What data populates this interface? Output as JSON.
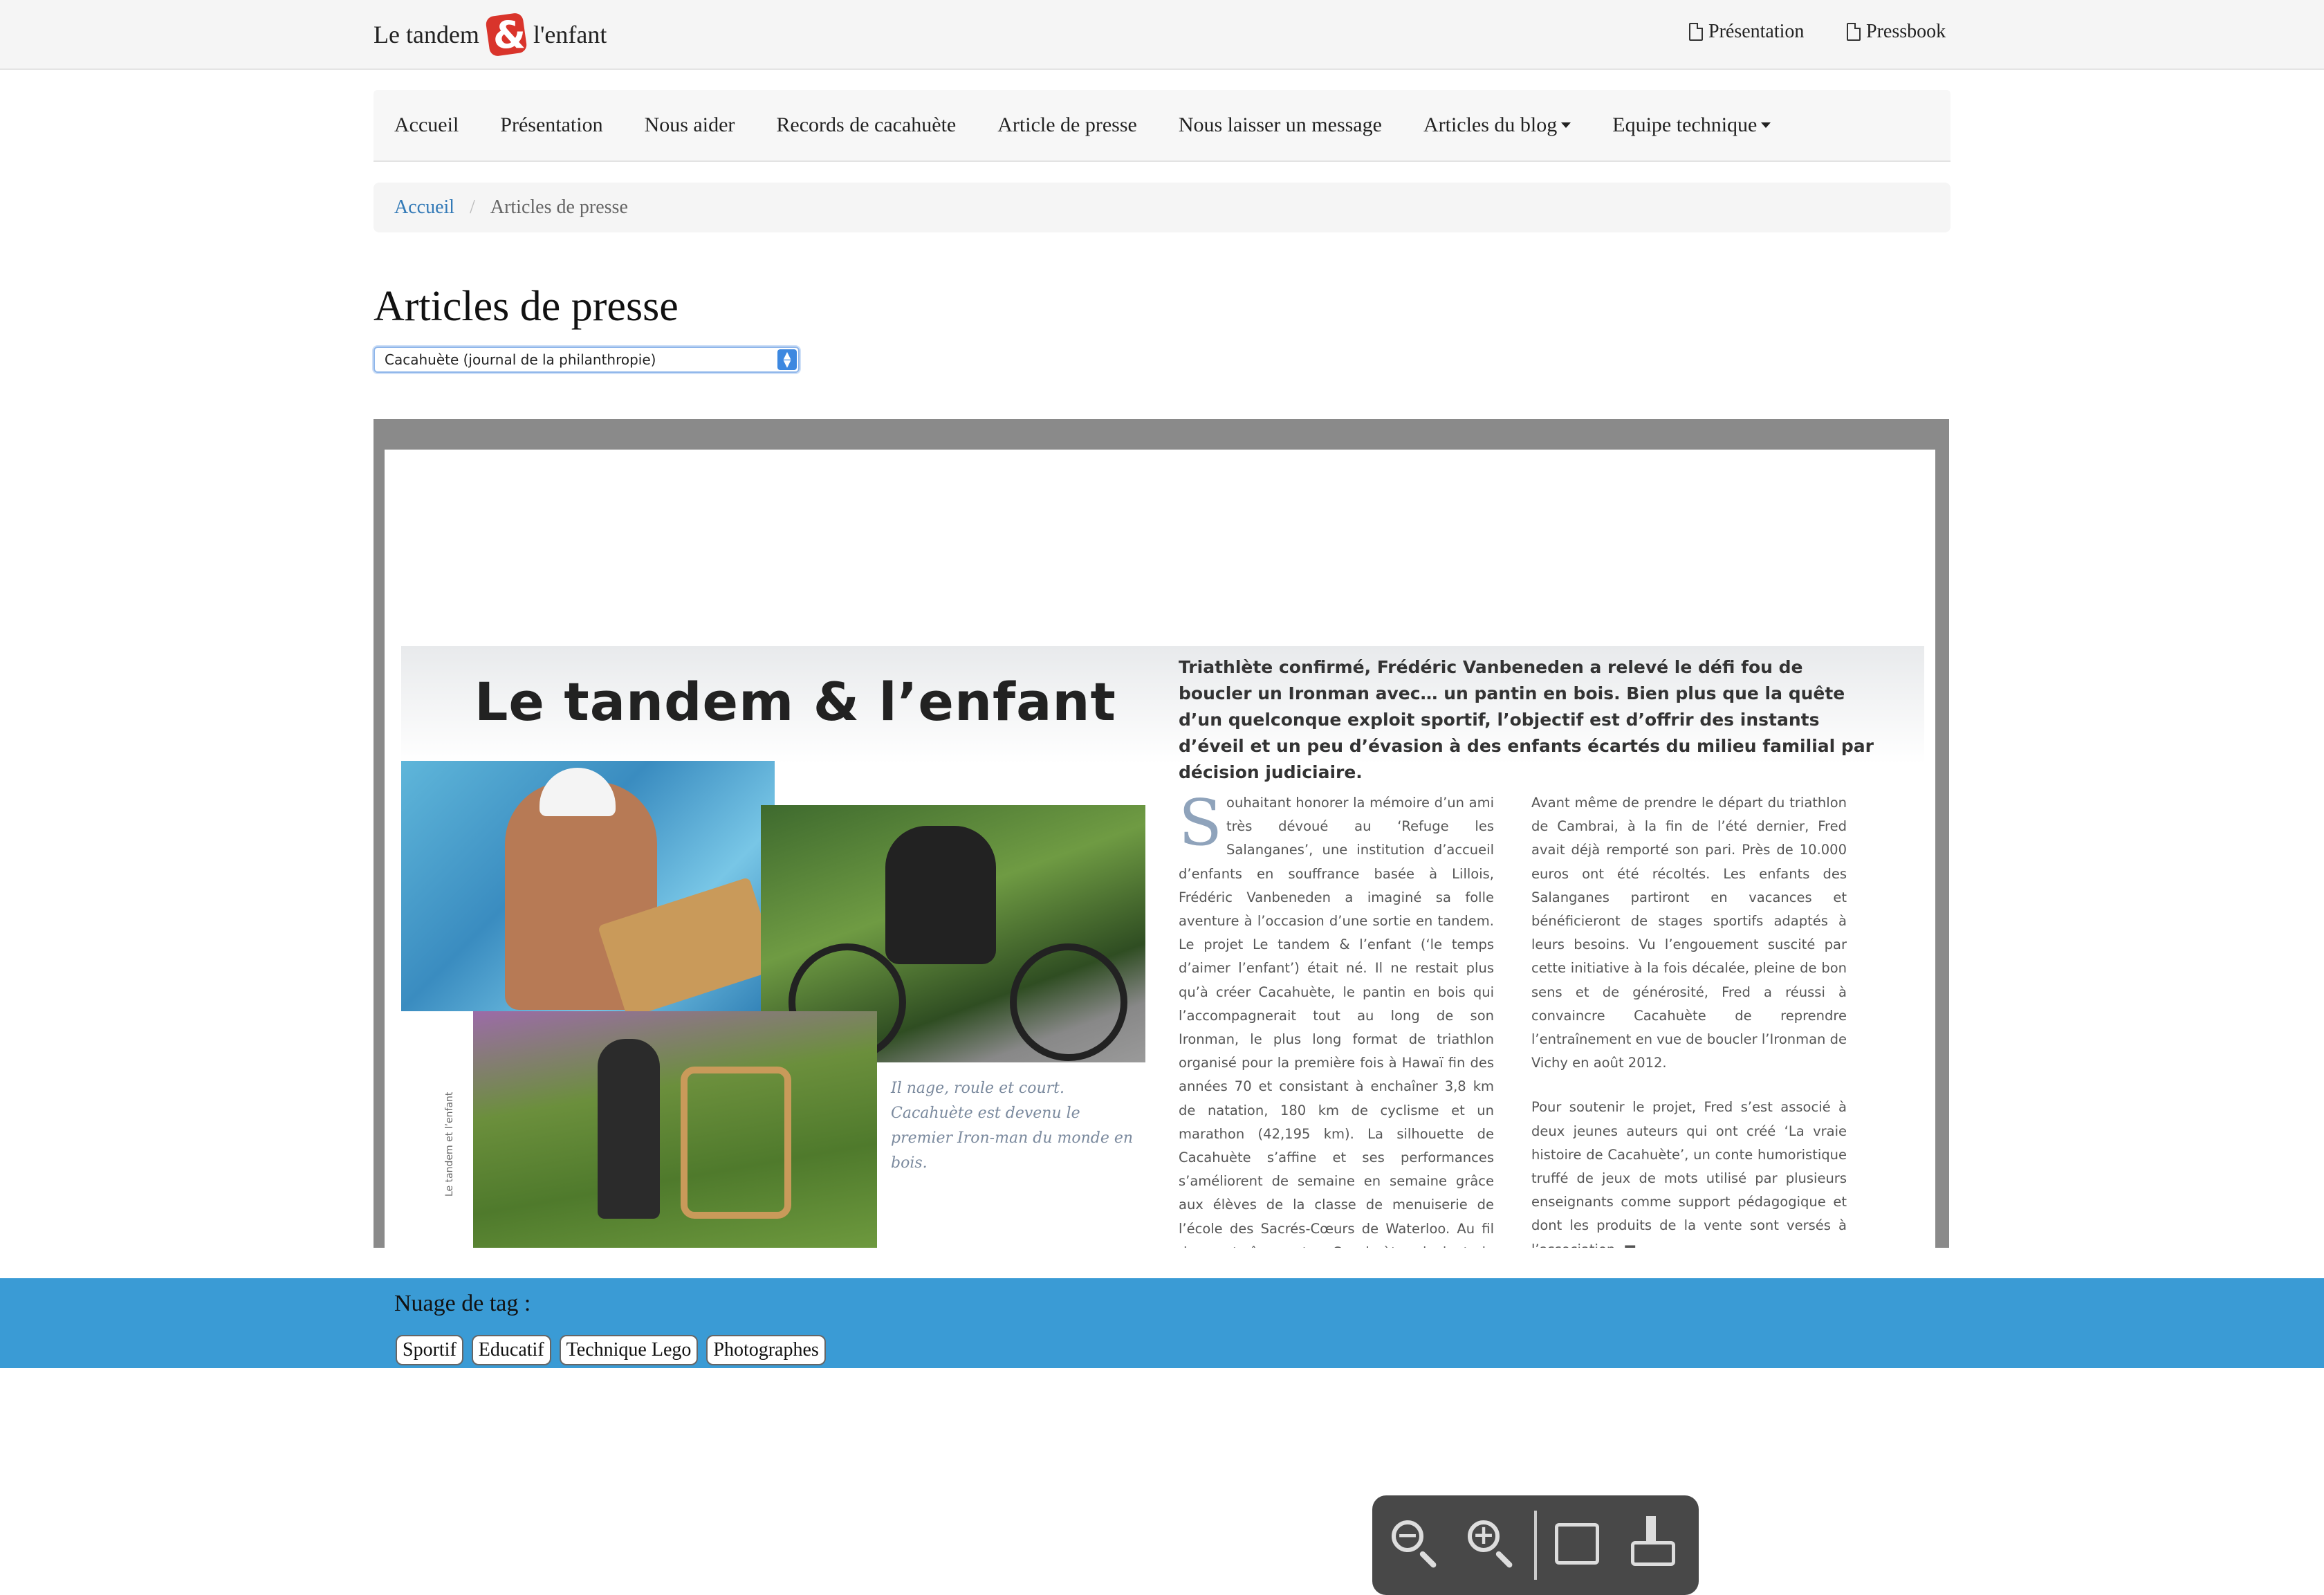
{
  "header": {
    "brand_left": "Le tandem",
    "brand_logo_letter": "&",
    "brand_right": "l'enfant",
    "links": [
      {
        "label": "Présentation",
        "icon": "pdf-icon"
      },
      {
        "label": "Pressbook",
        "icon": "pdf-icon"
      }
    ]
  },
  "nav": {
    "items": [
      {
        "label": "Accueil"
      },
      {
        "label": "Présentation"
      },
      {
        "label": "Nous aider"
      },
      {
        "label": "Records de cacahuète"
      },
      {
        "label": "Article de presse"
      },
      {
        "label": "Nous laisser un message"
      },
      {
        "label": "Articles du blog",
        "dropdown": true
      },
      {
        "label": "Equipe technique",
        "dropdown": true
      }
    ]
  },
  "breadcrumb": {
    "home": "Accueil",
    "separator": "/",
    "current": "Articles de presse"
  },
  "page_title": "Articles de presse",
  "article_select": {
    "selected": "Cacahuète (journal de la philanthropie)"
  },
  "document": {
    "title": "Le tandem & l’enfant",
    "intro": "Triathlète confirmé, Frédéric Vanbeneden a relevé le défi fou de boucler un Ironman avec… un pantin en bois. Bien plus que la quête d’un quelconque exploit sportif, l’objectif est d’offrir des instants d’éveil et un peu d’évasion à des enfants écartés du milieu familial par décision judiciaire.",
    "col1_dropcap": "S",
    "col1_text": "ouhaitant honorer la mémoire d’un ami très dévoué au ‘Refuge les Salanganes’, une institution d’accueil d’enfants en souffrance basée à Lillois, Frédéric Vanbeneden a imaginé sa folle aventure à l’occasion d’une sortie en tandem. Le projet Le tandem & l’enfant (‘le temps d’aimer l’enfant’) était né. Il ne restait plus qu’à créer Cacahuète, le pantin en bois qui l’accompagnerait tout au long de son Ironman, le plus long format de triathlon organisé pour la première fois à Hawaï fin des années 70 et consistant à enchaîner 3,8 km de natation, 180 km de cyclisme et un marathon (42,195 km). La silhouette de Cacahuète s’affine et ses performances s’améliorent de semaine en semaine grâce aux élèves de la classe de menuiserie de l’école des Sacrés-Cœurs de Waterloo. Au fil des entraînements, Cacahuète devient le héros de tout un quartier. Les messages de soutien s’accumulent sur le site du projet et les",
    "col2_p1": "Avant même de prendre le départ du triathlon de Cambrai, à la fin de l’été dernier, Fred avait déjà remporté son pari. Près de 10.000 euros ont été récoltés. Les enfants des Salanganes partiront en vacances et bénéficieront de stages sportifs adaptés à leurs besoins. Vu l’engouement suscité par cette initiative à la fois décalée, pleine de bon sens et de générosité, Fred a réussi à convaincre Cacahuète de reprendre l’entraînement en vue de boucler l’Ironman de Vichy en août 2012.",
    "col2_p2": "Pour soutenir le projet, Fred s’est associé à deux jeunes auteurs qui ont créé ‘La vraie histoire de Cacahuète’, un conte humoristique truffé de jeux de mots utilisé par plusieurs enseignants comme support pédagogique et dont les produits de la vente sont versés à l’association. ■",
    "photo_caption": "Il nage, roule et court. Cacahuète est devenu le premier Iron-man du monde en bois.",
    "vertical_caption": "Le tandem et l’enfant"
  },
  "viewer_toolbar": {
    "zoom_out": "−",
    "zoom_in": "+"
  },
  "footer": {
    "tag_cloud_label": "Nuage de tag :",
    "tags": [
      "Sportif",
      "Educatif",
      "Technique Lego",
      "Photographes"
    ]
  },
  "colors": {
    "link": "#337ab7",
    "footer_bg": "#3a9bd5",
    "logo_red": "#d9342b"
  }
}
